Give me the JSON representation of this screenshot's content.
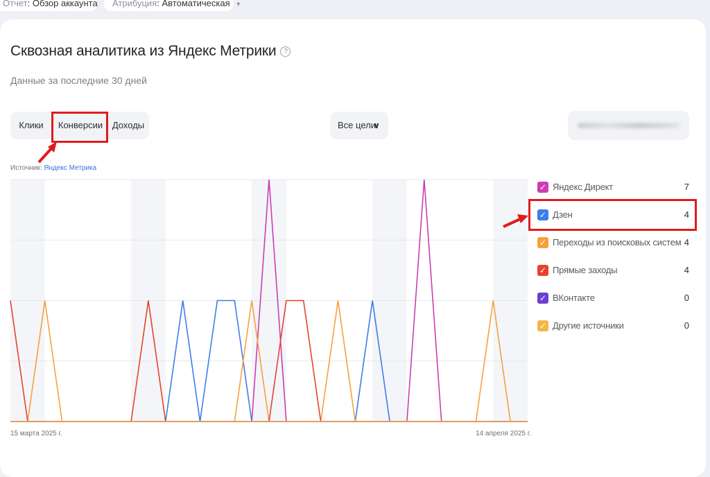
{
  "top_filters": [
    {
      "key": "Отчет",
      "value": "Обзор аккаунта"
    },
    {
      "key": "Атрибуция",
      "value": "Автоматическая"
    }
  ],
  "widget": {
    "title": "Сквозная аналитика из Яндекс Метрики",
    "subtitle": "Данные за последние 30 дней",
    "tabs": [
      "Клики",
      "Конверсии",
      "Доходы"
    ],
    "active_tab": "Конверсии",
    "goals_select": "Все цели",
    "source_label": "Источник:",
    "source_link": "Яндекс Метрика"
  },
  "chart_data": {
    "type": "line",
    "x_start_label": "15 марта 2025 г.",
    "x_end_label": "14 апреля 2025 г.",
    "days": 31,
    "weekend_shading": true,
    "series": [
      {
        "name": "Яндекс Директ",
        "color": "#cc3db0",
        "values": [
          0,
          0,
          0,
          0,
          0,
          0,
          0,
          0,
          0,
          0,
          0,
          0,
          0,
          0,
          0,
          2,
          0,
          0,
          0,
          0,
          0,
          0,
          0,
          0,
          2,
          0,
          0,
          0,
          0,
          0,
          0
        ]
      },
      {
        "name": "Дзен",
        "color": "#3c7de8",
        "values": [
          0,
          0,
          0,
          0,
          0,
          0,
          0,
          0,
          0,
          0,
          1,
          0,
          1,
          1,
          0,
          0,
          0,
          0,
          0,
          0,
          0,
          1,
          0,
          0,
          0,
          0,
          0,
          0,
          0,
          0,
          0
        ]
      },
      {
        "name": "Переходы из поисковых систем",
        "color": "#f7a03c",
        "values": [
          0,
          0,
          1,
          0,
          0,
          0,
          0,
          0,
          0,
          0,
          0,
          0,
          0,
          0,
          1,
          0,
          0,
          0,
          0,
          1,
          0,
          0,
          0,
          0,
          0,
          0,
          0,
          0,
          1,
          0,
          0
        ]
      },
      {
        "name": "Прямые заходы",
        "color": "#e5432b",
        "values": [
          1,
          0,
          0,
          0,
          0,
          0,
          0,
          0,
          1,
          0,
          0,
          0,
          0,
          0,
          0,
          0,
          1,
          1,
          0,
          0,
          0,
          0,
          0,
          0,
          0,
          0,
          0,
          0,
          0,
          0,
          0
        ]
      },
      {
        "name": "ВКонтакте",
        "color": "#6b3fd4",
        "values": [
          0,
          0,
          0,
          0,
          0,
          0,
          0,
          0,
          0,
          0,
          0,
          0,
          0,
          0,
          0,
          0,
          0,
          0,
          0,
          0,
          0,
          0,
          0,
          0,
          0,
          0,
          0,
          0,
          0,
          0,
          0
        ]
      },
      {
        "name": "Другие источники",
        "color": "#f5b547",
        "values": [
          0,
          0,
          0,
          0,
          0,
          0,
          0,
          0,
          0,
          0,
          0,
          0,
          0,
          0,
          0,
          0,
          0,
          0,
          0,
          0,
          0,
          0,
          0,
          0,
          0,
          0,
          0,
          0,
          0,
          0,
          0
        ]
      }
    ],
    "ylim": [
      0,
      2
    ],
    "grid": true
  },
  "legend": [
    {
      "label": "Яндекс Директ",
      "value": "7",
      "color": "#cc3db0"
    },
    {
      "label": "Дзен",
      "value": "4",
      "color": "#3c7de8"
    },
    {
      "label": "Переходы из поисковых систем",
      "value": "4",
      "color": "#f7a03c"
    },
    {
      "label": "Прямые заходы",
      "value": "4",
      "color": "#e5432b"
    },
    {
      "label": "ВКонтакте",
      "value": "0",
      "color": "#6b3fd4"
    },
    {
      "label": "Другие источники",
      "value": "0",
      "color": "#f5b547"
    }
  ],
  "icons": {
    "help": "question-icon",
    "check": "check-icon",
    "chevron": "chevron-down-icon"
  }
}
